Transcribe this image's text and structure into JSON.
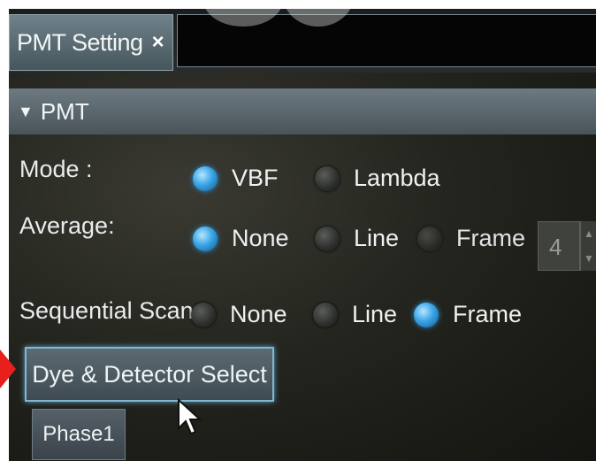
{
  "tab": {
    "title": "PMT Setting",
    "close_glyph": "×"
  },
  "section": {
    "title": "PMT",
    "expand_glyph": "▼"
  },
  "mode": {
    "label": "Mode :",
    "options": [
      {
        "label": "VBF",
        "selected": true
      },
      {
        "label": "Lambda",
        "selected": false
      }
    ]
  },
  "average": {
    "label": "Average:",
    "options": [
      {
        "label": "None",
        "selected": true
      },
      {
        "label": "Line",
        "selected": false
      },
      {
        "label": "Frame",
        "selected": false,
        "disabled": true
      }
    ],
    "count_value": "4"
  },
  "sequential_scan": {
    "label": "Sequential Scan",
    "options": [
      {
        "label": "None",
        "selected": false
      },
      {
        "label": "Line",
        "selected": false
      },
      {
        "label": "Frame",
        "selected": true
      }
    ]
  },
  "buttons": {
    "dye_detector_select": "Dye & Detector Select",
    "phase1": "Phase1"
  },
  "icons": {
    "tab_close": "close-icon",
    "section_toggle": "triangle-down-icon",
    "cursor": "mouse-pointer-icon",
    "callout": "red-arrow-marker-icon"
  },
  "colors": {
    "radio_selected": "#3aa6e6",
    "callout": "#e8201c",
    "button_border": "#84b6cf"
  }
}
